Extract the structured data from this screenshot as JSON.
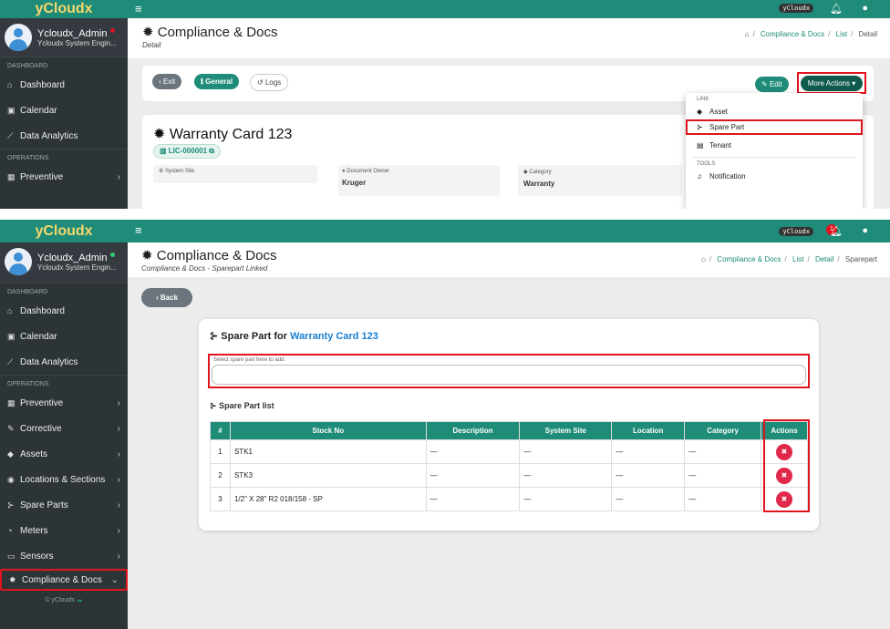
{
  "app": {
    "brand": "yCloudx",
    "org_badge": "yCloudx",
    "notif_count": "1"
  },
  "user": {
    "name": "Ycloudx_Admin",
    "role": "Ycloudx System Engin..."
  },
  "sidebar": {
    "sections": {
      "dashboard": "DASHBOARD",
      "operations": "OPERATIONS"
    },
    "items": [
      {
        "label": "Dashboard",
        "icon": "home-icon"
      },
      {
        "label": "Calendar",
        "icon": "calendar-icon"
      },
      {
        "label": "Data Analytics",
        "icon": "chart-icon"
      },
      {
        "label": "Preventive",
        "icon": "calendar-icon"
      },
      {
        "label": "Corrective",
        "icon": "wrench-icon"
      },
      {
        "label": "Assets",
        "icon": "tag-icon"
      },
      {
        "label": "Locations & Sections",
        "icon": "map-icon"
      },
      {
        "label": "Spare Parts",
        "icon": "parts-icon"
      },
      {
        "label": "Meters",
        "icon": "gauge-icon"
      },
      {
        "label": "Sensors",
        "icon": "monitor-icon"
      },
      {
        "label": "Compliance & Docs",
        "icon": "badge-icon"
      }
    ],
    "footer": "© yClouds"
  },
  "top": {
    "title": "Compliance & Docs",
    "subtitle": "Detail",
    "breadcrumb": [
      "Compliance & Docs",
      "List",
      "Detail"
    ],
    "buttons": {
      "exit": "Exit",
      "general": "General",
      "logs": "Logs",
      "edit": "Edit",
      "more": "More Actions"
    },
    "record": {
      "title": "Warranty Card 123",
      "code": "LIC-000001",
      "fields": [
        {
          "label": "System Site",
          "value": ""
        },
        {
          "label": "Document Owner",
          "value": "Kruger"
        },
        {
          "label": "Category",
          "value": "Warranty"
        }
      ]
    },
    "dropdown": {
      "link_header": "LINK",
      "link_items": [
        "Asset",
        "Spare Part",
        "Tenant"
      ],
      "tools_header": "TOOLS",
      "tools_items": [
        "Notification"
      ]
    }
  },
  "bottom": {
    "title": "Compliance & Docs",
    "subtitle": "Compliance & Docs - Sparepart Linked",
    "breadcrumb": [
      "Compliance & Docs",
      "List",
      "Detail",
      "Sparepart"
    ],
    "back": "Back",
    "panel_title_prefix": "Spare Part for",
    "panel_title_link": "Warranty Card 123",
    "input_label": "Select spare part here to add.",
    "input_value": "",
    "list_title": "Spare Part list",
    "columns": [
      "#",
      "Stock No",
      "Description",
      "System Site",
      "Location",
      "Category",
      "Actions"
    ],
    "rows": [
      [
        "1",
        "STK1",
        "—",
        "—",
        "—",
        "—"
      ],
      [
        "2",
        "STK3",
        "—",
        "—",
        "—",
        "—"
      ],
      [
        "3",
        "1/2\" X 28\" R2 018/158 - SP",
        "—",
        "—",
        "—",
        "—"
      ]
    ]
  },
  "colors": {
    "primary": "#1e8c78",
    "sidebar": "#2d3436",
    "highlight": "#e0141e",
    "brand_text": "#f5d76e",
    "delete": "#e0294a"
  }
}
